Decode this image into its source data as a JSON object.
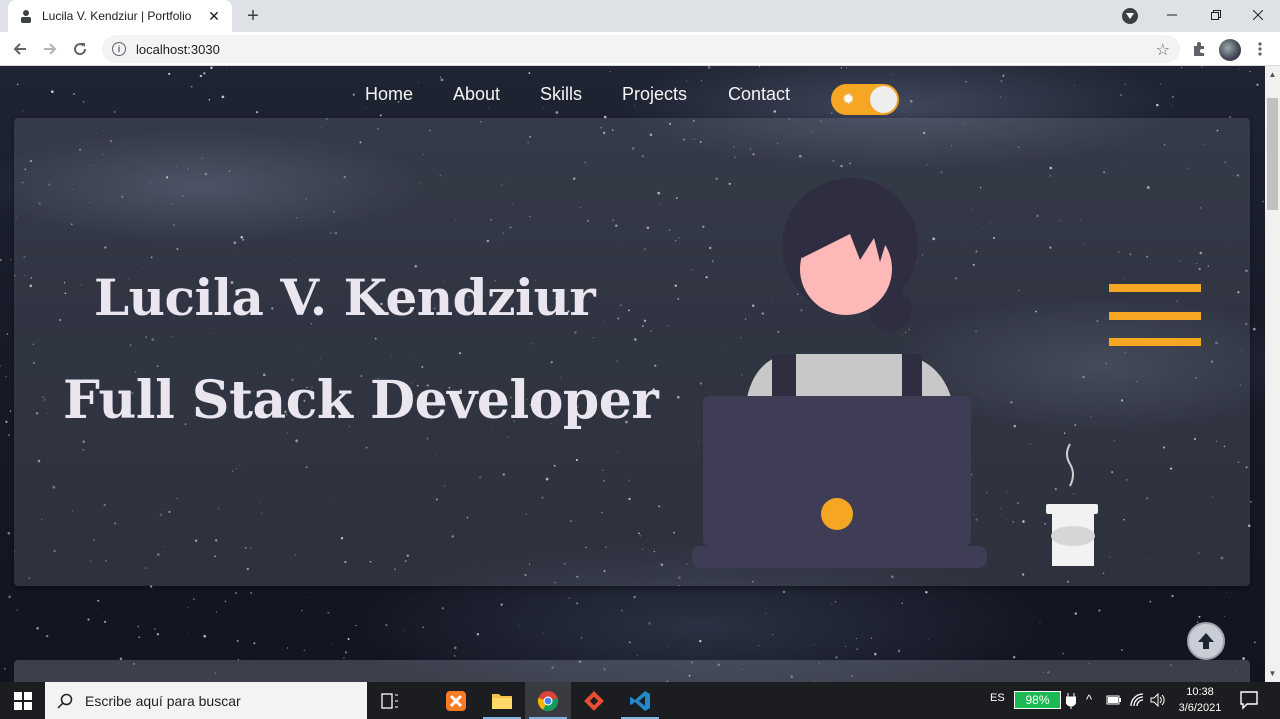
{
  "browser": {
    "tab_title": "Lucila V. Kendziur | Portfolio",
    "url": "localhost:3030"
  },
  "nav": {
    "links": [
      "Home",
      "About",
      "Skills",
      "Projects",
      "Contact"
    ]
  },
  "hero": {
    "name": "Lucila V. Kendziur",
    "role": "Full Stack Developer"
  },
  "colors": {
    "accent": "#f5a623",
    "hero_text": "#e9e6f0",
    "laptop": "#3f3d56"
  },
  "icons": {
    "theme_toggle": "sun-icon",
    "menu": "hamburger-menu-icon",
    "back_to_top": "arrow-up-icon"
  },
  "taskbar": {
    "search_placeholder": "Escribe aquí para buscar",
    "language": "ES",
    "battery": "98%",
    "time": "10:38",
    "date": "3/6/2021"
  }
}
